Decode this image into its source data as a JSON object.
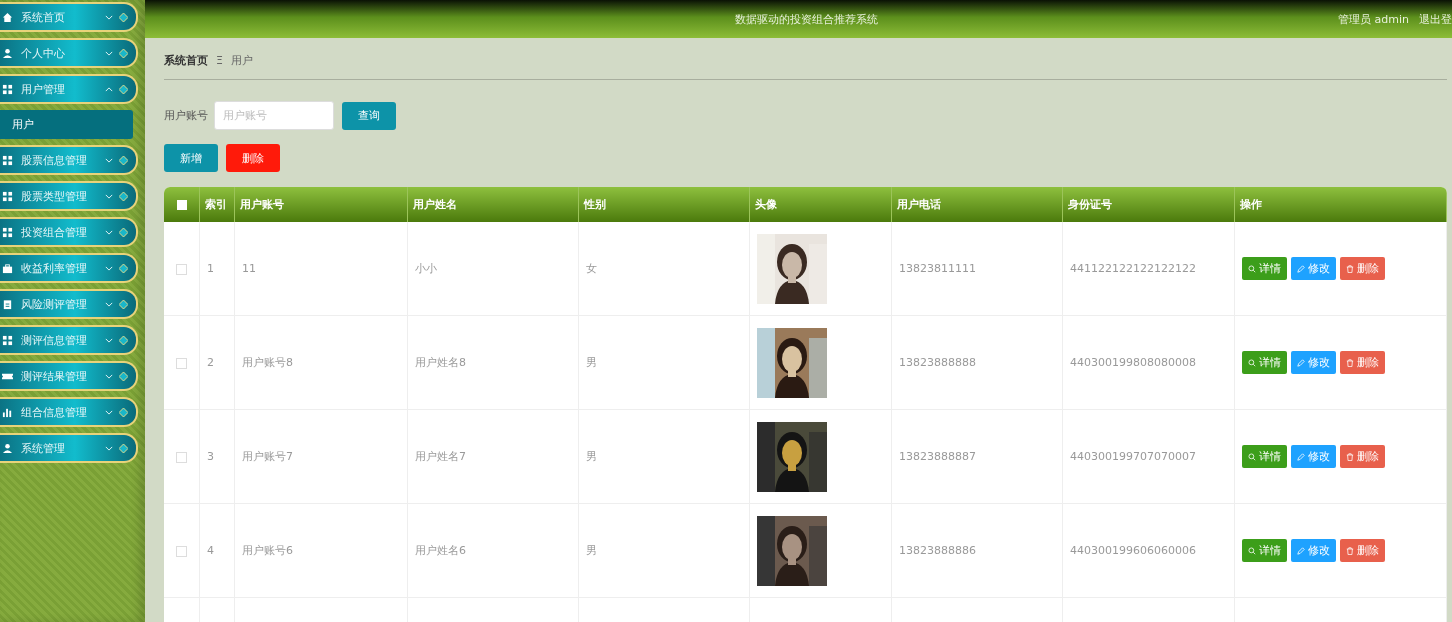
{
  "header": {
    "title": "数据驱动的投资组合推荐系统",
    "user": "管理员 admin",
    "logout": "退出登"
  },
  "sidebar": {
    "items": [
      {
        "label": "系统首页",
        "expanded": false
      },
      {
        "label": "个人中心",
        "expanded": false
      },
      {
        "label": "用户管理",
        "expanded": true,
        "children": [
          {
            "label": "用户",
            "selected": true
          }
        ]
      },
      {
        "label": "股票信息管理",
        "expanded": false
      },
      {
        "label": "股票类型管理",
        "expanded": false
      },
      {
        "label": "投资组合管理",
        "expanded": false
      },
      {
        "label": "收益利率管理",
        "expanded": false
      },
      {
        "label": "风险测评管理",
        "expanded": false
      },
      {
        "label": "测评信息管理",
        "expanded": false
      },
      {
        "label": "测评结果管理",
        "expanded": false
      },
      {
        "label": "组合信息管理",
        "expanded": false
      },
      {
        "label": "系统管理",
        "expanded": false
      }
    ]
  },
  "breadcrumb": {
    "home": "系统首页",
    "separator": "Ξ",
    "current": "用户"
  },
  "search": {
    "label": "用户账号",
    "placeholder": "用户账号",
    "button": "查询"
  },
  "toolbar": {
    "add": "新增",
    "delete": "删除"
  },
  "table": {
    "select_all": {
      "checked": false
    },
    "columns": [
      "索引",
      "用户账号",
      "用户姓名",
      "性别",
      "头像",
      "用户电话",
      "身份证号",
      "操作"
    ],
    "rows": [
      {
        "checked": false,
        "index": "1",
        "account": "11",
        "name": "小小",
        "gender": "女",
        "avatar": {
          "kind": "picture"
        },
        "phone": "13823811111",
        "id_number": "441122122122122122",
        "actions": [
          {
            "kind": "view",
            "label": "详情"
          },
          {
            "kind": "edit",
            "label": "修改"
          },
          {
            "kind": "delete",
            "label": "删除"
          }
        ]
      },
      {
        "checked": false,
        "index": "2",
        "account": "用户账号8",
        "name": "用户姓名8",
        "gender": "男",
        "avatar": {
          "kind": "picture"
        },
        "phone": "13823888888",
        "id_number": "440300199808080008",
        "actions": [
          {
            "kind": "view",
            "label": "详情"
          },
          {
            "kind": "edit",
            "label": "修改"
          },
          {
            "kind": "delete",
            "label": "删除"
          }
        ]
      },
      {
        "checked": false,
        "index": "3",
        "account": "用户账号7",
        "name": "用户姓名7",
        "gender": "男",
        "avatar": {
          "kind": "picture"
        },
        "phone": "13823888887",
        "id_number": "440300199707070007",
        "actions": [
          {
            "kind": "view",
            "label": "详情"
          },
          {
            "kind": "edit",
            "label": "修改"
          },
          {
            "kind": "delete",
            "label": "删除"
          }
        ]
      },
      {
        "checked": false,
        "index": "4",
        "account": "用户账号6",
        "name": "用户姓名6",
        "gender": "男",
        "avatar": {
          "kind": "picture"
        },
        "phone": "13823888886",
        "id_number": "440300199606060006",
        "actions": [
          {
            "kind": "view",
            "label": "详情"
          },
          {
            "kind": "edit",
            "label": "修改"
          },
          {
            "kind": "delete",
            "label": "删除"
          }
        ]
      }
    ]
  }
}
